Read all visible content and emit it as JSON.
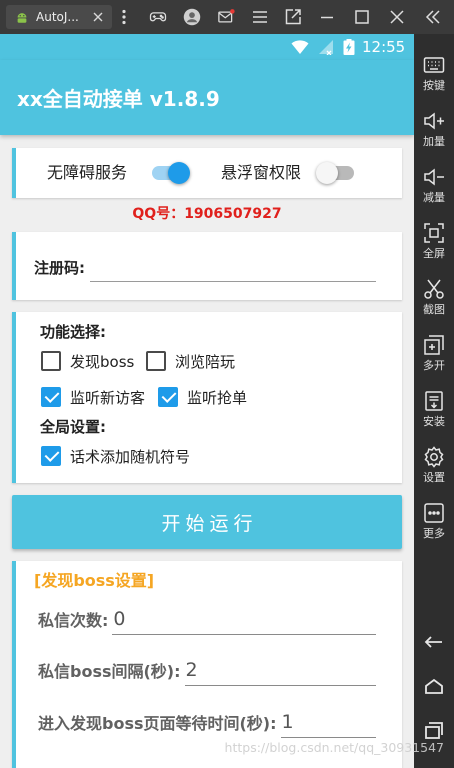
{
  "emulator": {
    "tab": {
      "title": "AutoJ...",
      "icon": "android-icon"
    },
    "toolbar_icons": [
      "more-vertical-icon",
      "gamepad-icon",
      "user-icon",
      "mail-icon",
      "menu-icon",
      "export-icon",
      "minimize-icon",
      "maximize-icon",
      "close-icon",
      "collapse-sidebar-icon"
    ],
    "sidebar": {
      "items": [
        {
          "label": "按键",
          "icon": "keyboard-icon"
        },
        {
          "label": "加量",
          "icon": "volume-up-icon"
        },
        {
          "label": "减量",
          "icon": "volume-down-icon"
        },
        {
          "label": "全屏",
          "icon": "fullscreen-icon"
        },
        {
          "label": "截图",
          "icon": "scissors-icon"
        },
        {
          "label": "多开",
          "icon": "multi-instance-icon"
        },
        {
          "label": "安装",
          "icon": "apk-install-icon"
        },
        {
          "label": "设置",
          "icon": "gear-icon"
        },
        {
          "label": "更多",
          "icon": "more-icon"
        }
      ],
      "nav_icons": [
        "back-icon",
        "home-icon",
        "recent-apps-icon"
      ]
    }
  },
  "status_bar": {
    "time": "12:55",
    "icons": [
      "wifi-icon",
      "signal-icon",
      "battery-charging-icon"
    ]
  },
  "app": {
    "title": "xx全自动接单 v1.8.9",
    "permissions": [
      {
        "label": "无障碍服务",
        "on": true
      },
      {
        "label": "悬浮窗权限",
        "on": false
      }
    ],
    "qq": "QQ号：1906507927",
    "register": {
      "label": "注册码:",
      "value": ""
    },
    "features": {
      "heading": "功能选择:",
      "options": [
        {
          "label": "发现boss",
          "checked": false
        },
        {
          "label": "浏览陪玩",
          "checked": false
        },
        {
          "label": "监听新访客",
          "checked": true
        },
        {
          "label": "监听抢单",
          "checked": true
        }
      ],
      "global_heading": "全局设置:",
      "global_options": [
        {
          "label": "话术添加随机符号",
          "checked": true
        }
      ]
    },
    "start_button": "开始运行",
    "boss_settings": {
      "heading": "[发现boss设置]",
      "fields": [
        {
          "label": "私信次数:",
          "value": "0"
        },
        {
          "label": "私信boss间隔(秒):",
          "value": "2"
        },
        {
          "label": "进入发现boss页面等待时间(秒):",
          "value": "1"
        }
      ]
    }
  },
  "watermark": "https://blog.csdn.net/qq_30931547",
  "colors": {
    "primary": "#4fc3df",
    "switch_on": "#1e9be9",
    "checkbox": "#1e9be9",
    "qq_text": "#e0201c",
    "section_heading": "#f5a623",
    "mail_badge": "#e53935"
  }
}
